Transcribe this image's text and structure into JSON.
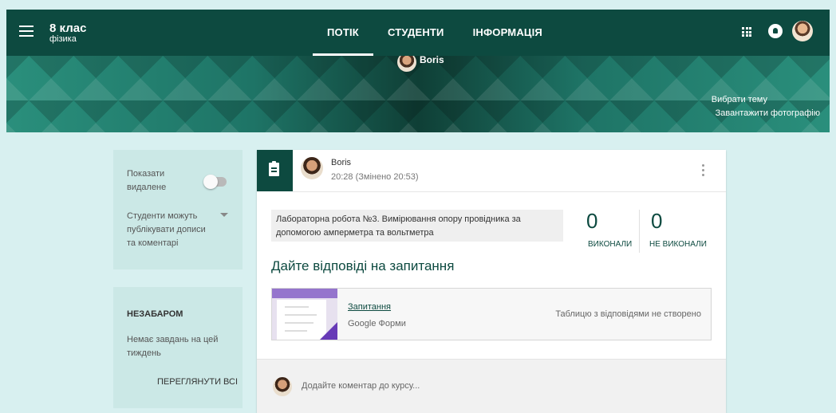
{
  "header": {
    "class_name": "8 клас",
    "subject": "фізика",
    "tabs": [
      {
        "label": "ПОТІК",
        "active": true
      },
      {
        "label": "СТУДЕНТИ",
        "active": false
      },
      {
        "label": "ІНФОРМАЦІЯ",
        "active": false
      }
    ],
    "icons": [
      "menu-icon",
      "apps-icon",
      "notifications-icon",
      "avatar"
    ]
  },
  "banner": {
    "owner_name": "Boris",
    "select_theme": "Вибрати тему",
    "upload_photo": "Завантажити фотографію"
  },
  "settings": {
    "show_deleted": "Показати видалене",
    "show_deleted_on": false,
    "student_permissions": "Студенти можуть публікувати дописи та коментарі"
  },
  "upcoming": {
    "title": "НЕЗАБАРОМ",
    "empty_text": "Немає завдань на цей тиждень",
    "view_all": "ПЕРЕГЛЯНУТИ ВСІ"
  },
  "post": {
    "author": "Boris",
    "time": "20:28 (Змінено 20:53)",
    "topic": "Лабораторна робота №3. Вимірювання опору провідника за допомогою амперметра та вольтметра",
    "done_count": "0",
    "done_label": "ВИКОНАЛИ",
    "not_done_count": "0",
    "not_done_label": "НЕ ВИКОНАЛИ",
    "title": "Дайте відповіді на запитання",
    "attachment": {
      "name": "Запитання",
      "type": "Google Форми",
      "status": "Таблицю з відповідями не створено"
    },
    "comment_placeholder": "Додайте коментар до курсу..."
  },
  "colors": {
    "primary": "#0d4a40",
    "background": "#d8f0f0",
    "forms_purple": "#673ab7"
  }
}
